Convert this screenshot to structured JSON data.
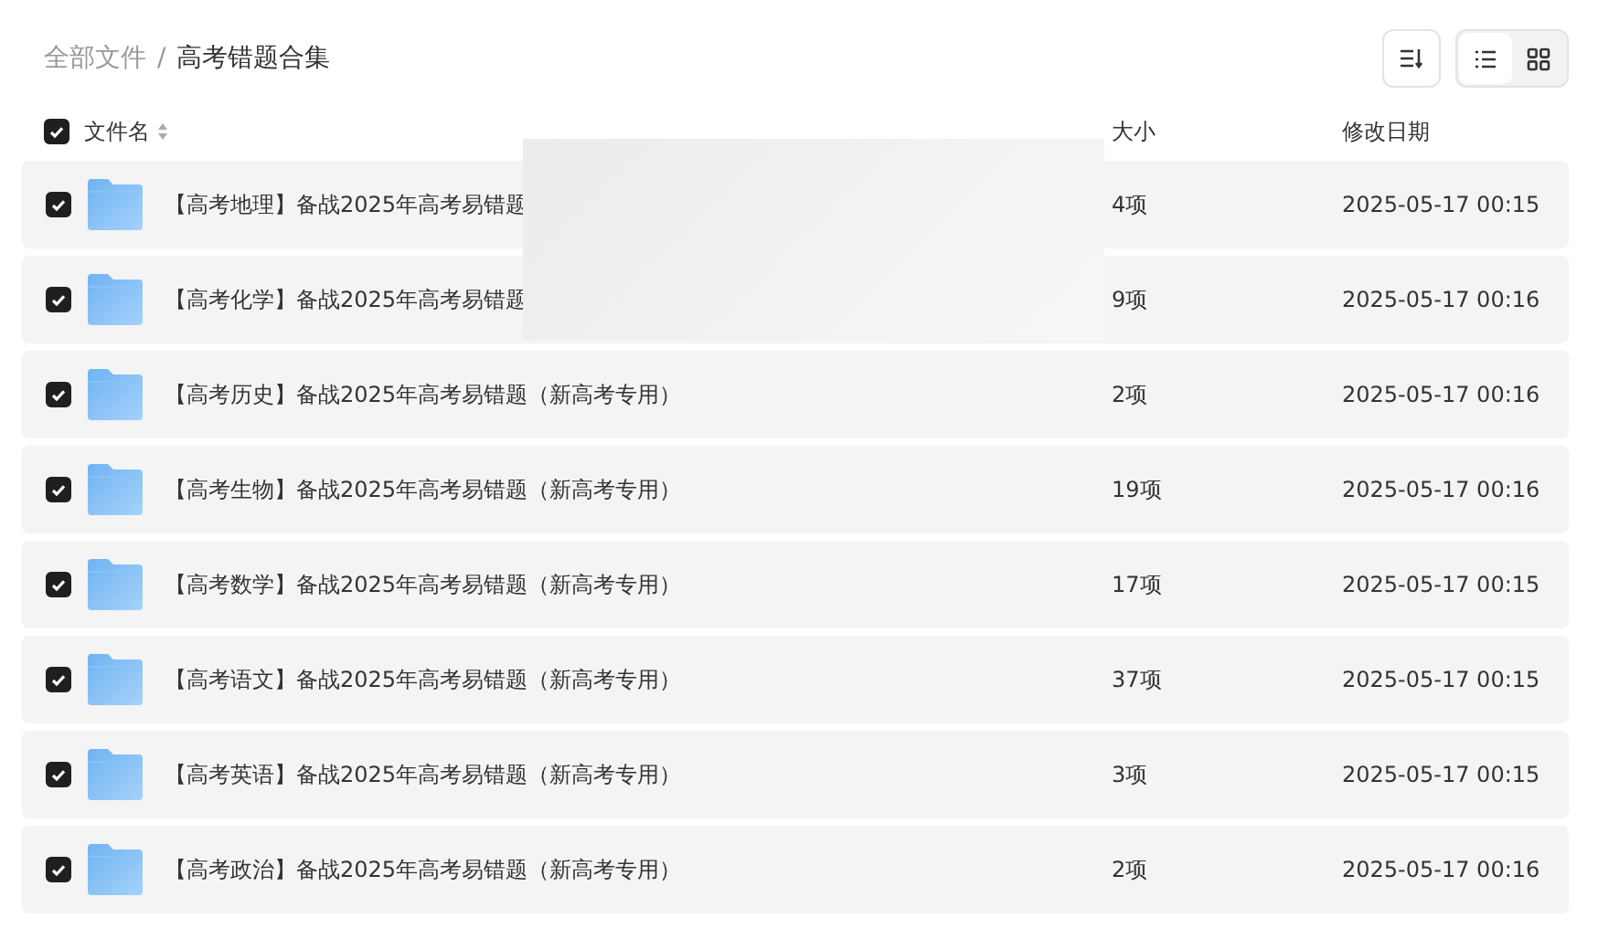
{
  "breadcrumb": [
    {
      "label": "全部文件",
      "current": false
    },
    {
      "label": "/",
      "current": false
    },
    {
      "label": "高考错题合集",
      "current": true
    }
  ],
  "view_modes": [
    {
      "kind": "list",
      "selected": true
    },
    {
      "kind": "grid",
      "selected": false
    }
  ],
  "header": {
    "checked": true,
    "name": "文件名",
    "size": "大小",
    "date": "修改日期"
  },
  "overlay": {
    "kind": "blank"
  },
  "files": [
    {
      "name": "【高考地理】备战2025年高考易错题",
      "size": "4项",
      "date": "2025-05-17 00:15",
      "checked": true
    },
    {
      "name": "【高考化学】备战2025年高考易错题",
      "size": "9项",
      "date": "2025-05-17 00:16",
      "checked": true
    },
    {
      "name": "【高考历史】备战2025年高考易错题（新高考专用）",
      "size": "2项",
      "date": "2025-05-17 00:16",
      "checked": true
    },
    {
      "name": "【高考生物】备战2025年高考易错题（新高考专用）",
      "size": "19项",
      "date": "2025-05-17 00:16",
      "checked": true
    },
    {
      "name": "【高考数学】备战2025年高考易错题（新高考专用）",
      "size": "17项",
      "date": "2025-05-17 00:15",
      "checked": true
    },
    {
      "name": "【高考语文】备战2025年高考易错题（新高考专用）",
      "size": "37项",
      "date": "2025-05-17 00:15",
      "checked": true
    },
    {
      "name": "【高考英语】备战2025年高考易错题（新高考专用）",
      "size": "3项",
      "date": "2025-05-17 00:15",
      "checked": true
    },
    {
      "name": "【高考政治】备战2025年高考易错题（新高考专用）",
      "size": "2项",
      "date": "2025-05-17 00:16",
      "checked": true
    }
  ]
}
